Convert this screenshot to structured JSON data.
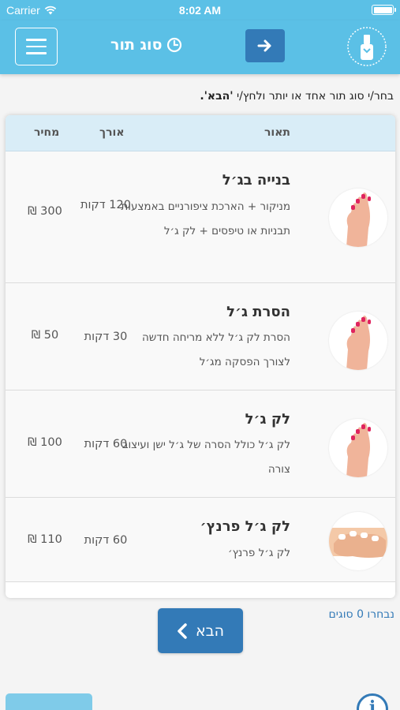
{
  "status_bar": {
    "carrier": "Carrier",
    "time": "8:02 AM"
  },
  "navbar": {
    "title": "סוג תור"
  },
  "instruction": {
    "text": "בחר/י סוג תור אחד או יותר ולחץ/י ",
    "highlight": "'הבא'."
  },
  "table": {
    "headers": {
      "description": "תאור",
      "duration": "אורך",
      "price": "מחיר"
    },
    "rows": [
      {
        "name": "בנייה בג׳ל",
        "desc": "מניקור + הארכת ציפורניים באמצעות תבניות או טיפסים + לק ג׳ל",
        "duration": "120 דקות",
        "price": "300 ₪",
        "image": "pink-nails-hand"
      },
      {
        "name": "הסרת ג׳ל",
        "desc": "הסרת לק ג׳ל ללא מריחה חדשה לצורך הפסקה מג׳ל",
        "duration": "30 דקות",
        "price": "50 ₪",
        "image": "pink-nails-hand"
      },
      {
        "name": "לק ג׳ל",
        "desc": "לק ג׳ל כולל הסרה של ג׳ל ישן ועיצוב צורה",
        "duration": "60 דקות",
        "price": "100 ₪",
        "image": "pink-nails-hand"
      },
      {
        "name": "לק ג׳ל פרנץ׳",
        "desc": "לק ג׳ל פרנץ׳",
        "duration": "60 דקות",
        "price": "110 ₪",
        "image": "french-nails-hand"
      }
    ]
  },
  "footer": {
    "selected_count": "נבחרו 0 סוגים",
    "next_label": "הבא"
  },
  "colors": {
    "header": "#5bc0e6",
    "primary": "#337ab7",
    "table_header": "#d9edf7"
  }
}
